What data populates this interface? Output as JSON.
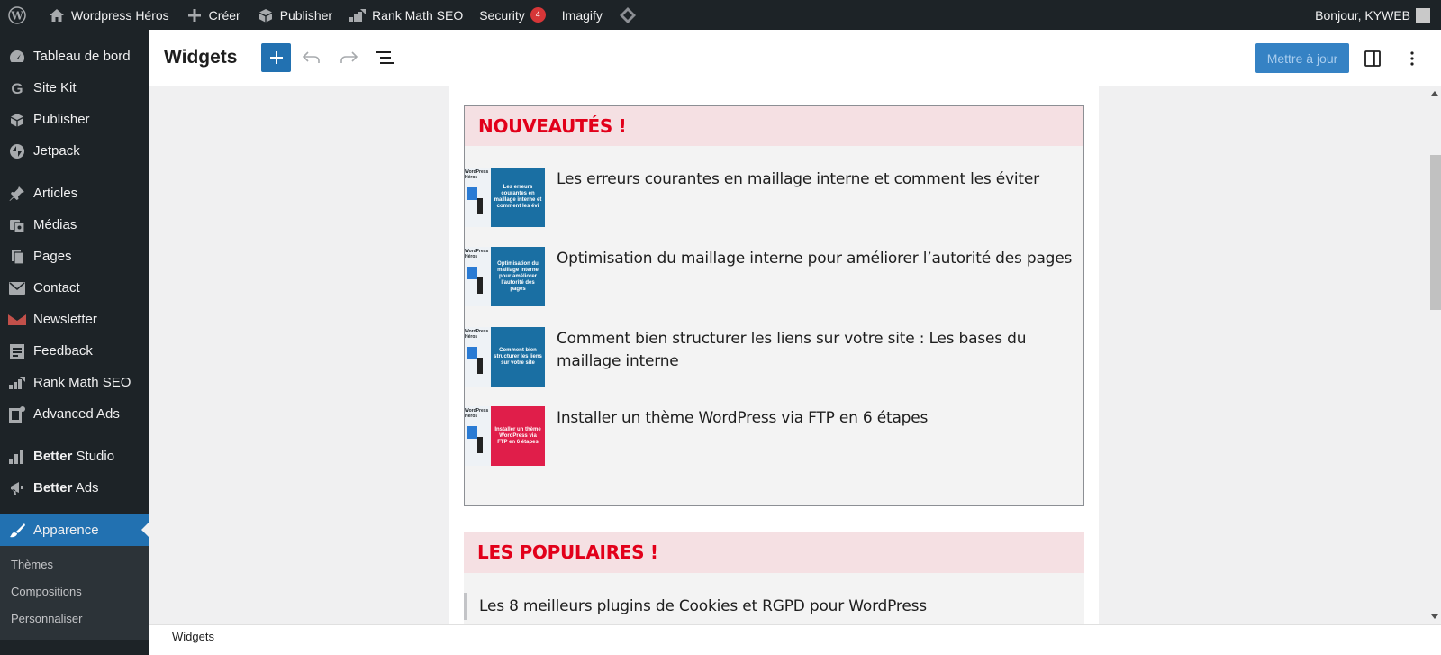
{
  "adminbar": {
    "site_name": "Wordpress Héros",
    "create_label": "Créer",
    "publisher_label": "Publisher",
    "rankmath_label": "Rank Math SEO",
    "security_label": "Security",
    "security_count": "4",
    "imagify_label": "Imagify",
    "greeting": "Bonjour, KYWEB"
  },
  "sidebar": {
    "items": [
      {
        "label": "Tableau de bord",
        "icon": "dashboard-icon"
      },
      {
        "label": "Site Kit",
        "icon": "google-icon"
      },
      {
        "label": "Publisher",
        "icon": "publisher-icon"
      },
      {
        "label": "Jetpack",
        "icon": "jetpack-icon"
      },
      {
        "label": "Articles",
        "icon": "pin-icon"
      },
      {
        "label": "Médias",
        "icon": "media-icon"
      },
      {
        "label": "Pages",
        "icon": "pages-icon"
      },
      {
        "label": "Contact",
        "icon": "mail-icon"
      },
      {
        "label": "Newsletter",
        "icon": "newsletter-icon"
      },
      {
        "label": "Feedback",
        "icon": "feedback-icon"
      },
      {
        "label": "Rank Math SEO",
        "icon": "rankmath-icon"
      },
      {
        "label": "Advanced Ads",
        "icon": "ads-icon"
      }
    ],
    "better_studio": {
      "bold": "Better",
      "rest": " Studio"
    },
    "better_ads": {
      "bold": "Better",
      "rest": " Ads"
    },
    "active": "Apparence",
    "submenu": [
      "Thèmes",
      "Compositions",
      "Personnaliser"
    ]
  },
  "editor": {
    "title": "Widgets",
    "update_label": "Mettre à jour"
  },
  "widgets": {
    "news_title": "NOUVEAUTÉS !",
    "posts": [
      {
        "title": "Les erreurs courantes en maillage interne et comment les éviter",
        "thumb_text": "Les erreurs courantes en maillage interne et comment les évi",
        "thumb_color": "#1a6fa3"
      },
      {
        "title": "Optimisation du maillage interne pour améliorer l’autorité des pages",
        "thumb_text": "Optimisation du maillage interne pour améliorer l’autorité des pages",
        "thumb_color": "#1a6fa3"
      },
      {
        "title": "Comment bien structurer les liens sur votre site : Les bases du maillage interne",
        "thumb_text": "Comment bien structurer les liens sur votre site",
        "thumb_color": "#1a6fa3"
      },
      {
        "title": "Installer un thème WordPress via FTP en 6 étapes",
        "thumb_text": "Installer un thème WordPress via FTP en 6 étapes",
        "thumb_color": "#e01e4a"
      }
    ],
    "popular_title": "LES POPULAIRES !",
    "popular_first": "Les 8 meilleurs plugins de Cookies et RGPD pour WordPress"
  },
  "footer": {
    "breadcrumb": "Widgets"
  }
}
